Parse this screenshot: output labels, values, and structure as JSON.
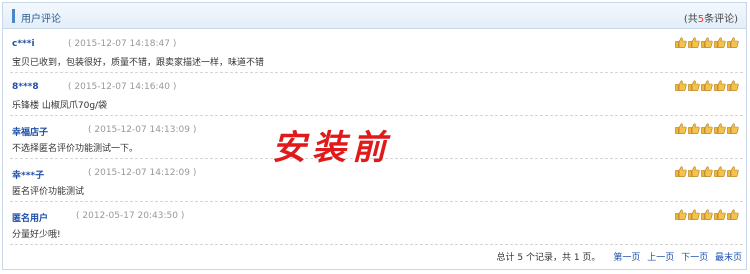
{
  "header": {
    "title": "用户评论",
    "total_prefix": "(共",
    "total_count": "5",
    "total_suffix": "条评论)"
  },
  "comments": [
    {
      "user": "c***i",
      "time": "( 2015-12-07 14:18:47 )",
      "text": "宝贝已收到，包装很好，质量不错，跟卖家描述一样，味道不错",
      "rating": 5
    },
    {
      "user": "8***8",
      "time": "( 2015-12-07 14:16:40 )",
      "text": "乐锋楼 山椒凤爪70g/袋",
      "rating": 5
    },
    {
      "user": "幸福店子",
      "time": "( 2015-12-07 14:13:09 )",
      "text": "不选择匿名评价功能测试一下。",
      "rating": 5
    },
    {
      "user": "幸***子",
      "time": "( 2015-12-07 14:12:09 )",
      "text": "匿名评价功能测试",
      "rating": 5
    },
    {
      "user": "匿名用户",
      "time": "( 2012-05-17 20:43:50 )",
      "text": "分量好少哦!",
      "rating": 5
    }
  ],
  "stamp_text": "安装前",
  "pager": {
    "summary": "总计 5 个记录，共 1 页。",
    "first": "第一页",
    "prev": "上一页",
    "next": "下一页",
    "last": "最末页"
  },
  "colors": {
    "accent": "#1f4fa8",
    "stamp": "#e01a1a",
    "thumb": "#f2b53c"
  },
  "icons": {
    "rating": "thumbs-up-icon"
  }
}
